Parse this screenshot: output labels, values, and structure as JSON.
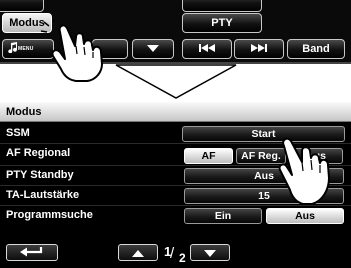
{
  "topbar": {
    "modus_label": "Modus",
    "pty_label": "PTY",
    "menu_label": "MENU",
    "band_label": "Band",
    "icons": [
      "music-note-icon",
      "down-arrow-icon",
      "skip-back-icon",
      "skip-forward-icon"
    ]
  },
  "menu": {
    "title": "Modus",
    "rows": [
      {
        "label": "SSM",
        "buttons": [
          {
            "label": "Start"
          }
        ]
      },
      {
        "label": "AF Regional",
        "buttons": [
          {
            "label": "AF"
          },
          {
            "label": "AF Reg."
          },
          {
            "label": "Aus"
          }
        ]
      },
      {
        "label": "PTY Standby",
        "buttons": [
          {
            "label": "Aus"
          }
        ]
      },
      {
        "label": "TA-Lautstärke",
        "buttons": [
          {
            "label": "15"
          }
        ]
      },
      {
        "label": "Programmsuche",
        "buttons": [
          {
            "label": "Ein"
          },
          {
            "label": "Aus"
          }
        ]
      }
    ]
  },
  "pager": {
    "current": "1",
    "total": "2"
  },
  "icons": {
    "back": "back-arrow-icon",
    "up": "up-arrow-icon",
    "down": "down-arrow-icon",
    "hand": "pointing-hand-icon"
  }
}
